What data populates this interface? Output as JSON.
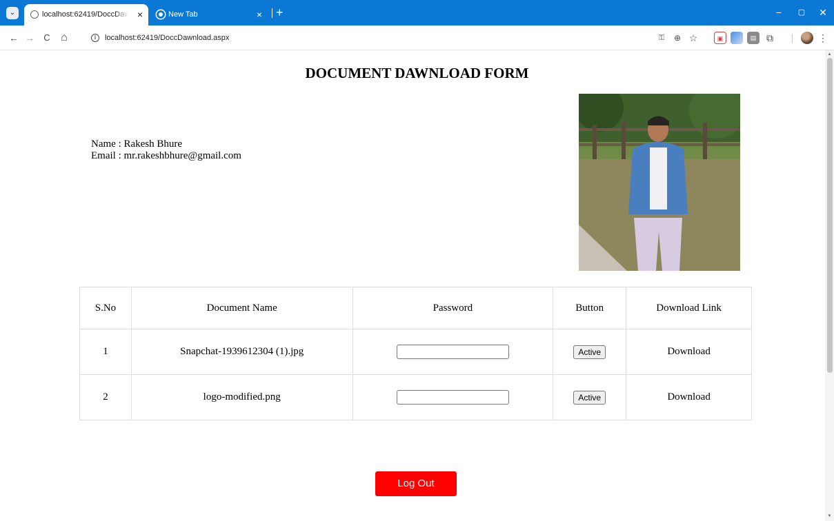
{
  "browser": {
    "tabs": [
      {
        "title": "localhost:62419/DoccDawnload.aspx",
        "close": "×"
      },
      {
        "title": "New Tab",
        "close": "×"
      }
    ],
    "new_tab": "+",
    "window": {
      "minimize": "−",
      "restore": "▢",
      "close": "✕"
    },
    "url": "localhost:62419/DoccDawnload.aspx",
    "nav": {
      "back": "←",
      "forward": "→",
      "reload": "C",
      "home": "⌂"
    },
    "menu": "⋮"
  },
  "page": {
    "heading": "DOCUMENT DAWNLOAD FORM",
    "name_line": "Name : Rakesh Bhure",
    "email_line": "Email : mr.rakeshbhure@gmail.com",
    "table": {
      "headers": [
        "S.No",
        "Document Name",
        "Password",
        "Button",
        "Download Link"
      ],
      "rows": [
        {
          "sno": "1",
          "document": "Snapchat-1939612304 (1).jpg",
          "password": "",
          "button": "Active",
          "link": "Download"
        },
        {
          "sno": "2",
          "document": "logo-modified.png",
          "password": "",
          "button": "Active",
          "link": "Download"
        }
      ]
    },
    "logout": "Log Out"
  },
  "colors": {
    "tabstrip": "#0a78d4",
    "logout_button": "#ff0000"
  }
}
